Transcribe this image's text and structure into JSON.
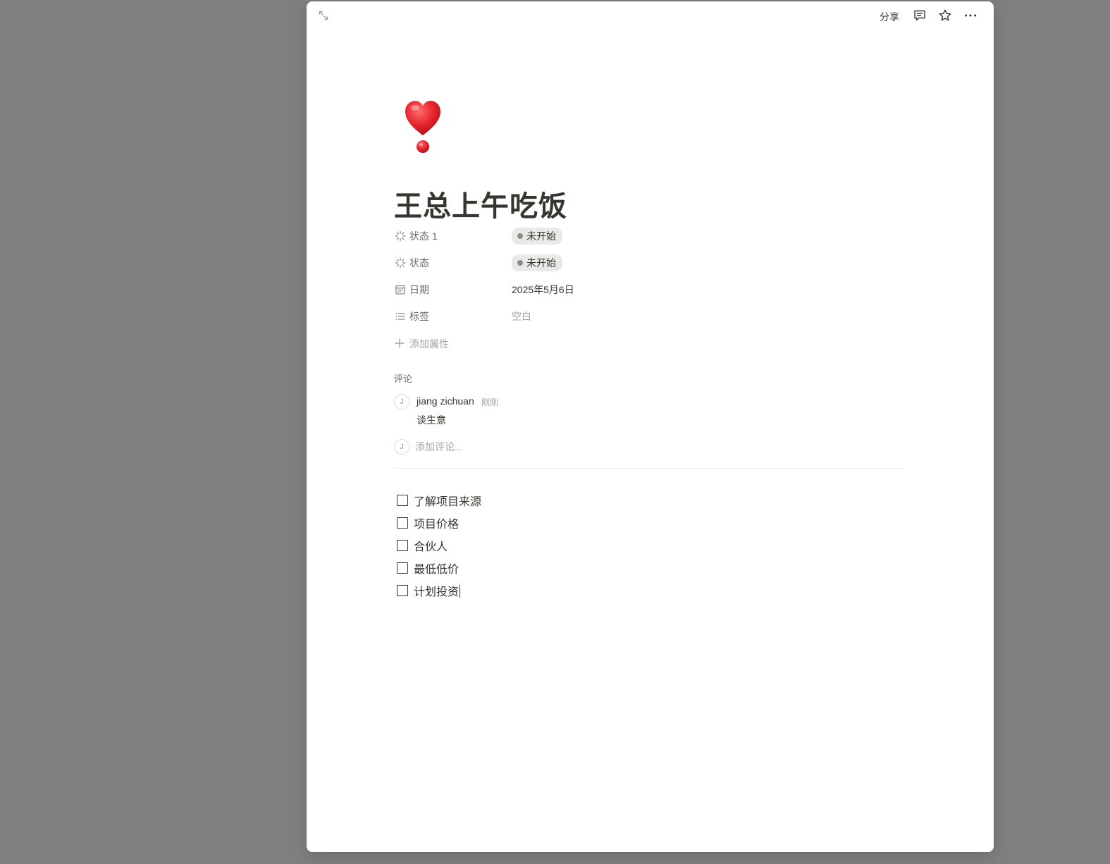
{
  "topbar": {
    "share_label": "分享",
    "icons": [
      "expand-icon",
      "comment-icon",
      "star-icon",
      "more-icon"
    ]
  },
  "page": {
    "icon": "heavy-heart-exclamation-emoji",
    "title": "王总上午吃饭"
  },
  "properties": [
    {
      "icon": "status-icon",
      "name": "状态 1",
      "value": "未开始",
      "type": "status"
    },
    {
      "icon": "status-icon",
      "name": "状态",
      "value": "未开始",
      "type": "status"
    },
    {
      "icon": "calendar-icon",
      "name": "日期",
      "value": "2025年5月6日",
      "type": "date"
    },
    {
      "icon": "list-icon",
      "name": "标签",
      "value": "空白",
      "type": "empty"
    }
  ],
  "add_property_label": "添加属性",
  "comments": {
    "label": "评论",
    "items": [
      {
        "avatar": "J",
        "author": "jiang zichuan",
        "time": "刚刚",
        "body": "谈生意"
      }
    ],
    "input_avatar": "J",
    "input_placeholder": "添加评论..."
  },
  "todos": [
    {
      "text": "了解项目来源",
      "checked": false
    },
    {
      "text": "项目价格",
      "checked": false
    },
    {
      "text": "合伙人",
      "checked": false
    },
    {
      "text": "最低低价",
      "checked": false
    },
    {
      "text": "计划投资",
      "checked": false
    }
  ],
  "colors": {
    "backdrop": "#7f7f7f",
    "page": "#ffffff",
    "text": "#37352f",
    "muted": "#a5a4a0",
    "status_pill": "#e9e9e7",
    "heart": "#e3242b"
  }
}
